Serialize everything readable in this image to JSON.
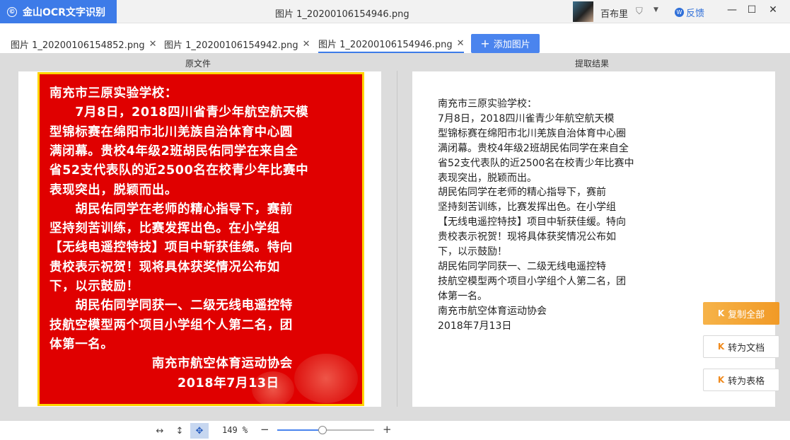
{
  "app": {
    "name": "金山OCR文字识别",
    "logo_icon": "copyright-circle-icon",
    "window_title": "图片 1_20200106154946.png",
    "accent_color": "#3d7be8"
  },
  "user": {
    "name": "百布里"
  },
  "header": {
    "feedback_label": "反馈"
  },
  "window_controls": {
    "minimize": "—",
    "maximize": "☐",
    "close": "✕"
  },
  "tabs": [
    {
      "label": "图片 1_20200106154852.png",
      "active": false
    },
    {
      "label": "图片 1_20200106154942.png",
      "active": false
    },
    {
      "label": "图片 1_20200106154946.png",
      "active": true
    }
  ],
  "add_image_label": "添加图片",
  "panes": {
    "original_title": "原文件",
    "result_title": "提取结果"
  },
  "original_image_lines": [
    "南充市三原实验学校：",
    "　　7月8日，2018四川省青少年航空航天模",
    "型锦标赛在绵阳市北川羌族自治体育中心圆",
    "满闭幕。贵校4年级2班胡民佑同学在来自全",
    "省52支代表队的近2500名在校青少年比赛中",
    "表现突出，脱颖而出。",
    "　　胡民佑同学在老师的精心指导下，赛前",
    "坚持刻苦训练，比赛发挥出色。在小学组",
    "【无线电遥控特技】项目中斩获佳绩。特向",
    "贵校表示祝贺！现将具体获奖情况公布如",
    "下，以示鼓励！",
    "　　胡民佑同学同获一、二级无线电遥控特",
    "技航空模型两个项目小学组个人第二名，团",
    "体第一名。",
    "　　　　　　　　南充市航空体育运动协会",
    "　　　　　　　　　　2018年7月13日"
  ],
  "result_lines": [
    "南充市三原实验学校：",
    "7月8日，2018四川雀青少年航空航天模",
    "型锦标赛在绵阳市北川羌族自治体育中心圈",
    "满闭幕。贵校4年级2班胡民佑同学在来自全",
    "省52支代表队的近2500名在校青少年比赛中",
    "表现突出，脱颖而出。",
    "胡民佑同学在老师的精心指导下，赛前",
    "坚持刻苦训练，比赛发挥出色。在小学组",
    "【无线电遥控特技】项目中斩获佳缓。特向",
    "贵校表示祝贺！现将具体获奖情况公布如",
    "下，以示鼓励！",
    "胡民佑同学同获一、二级无线电遥控特",
    "技航空模型两个项目小学组个人第二名，团",
    "体第一名。",
    "南充市航空体育运动协会",
    "2018年7月13日"
  ],
  "actions": {
    "copy_all": "复制全部",
    "to_document": "转为文档",
    "to_table": "转为表格"
  },
  "bottom": {
    "zoom_label": "149 %",
    "zoom_fraction": 0.47,
    "tools": [
      "fit-width-icon",
      "fit-height-icon",
      "move-icon"
    ]
  }
}
